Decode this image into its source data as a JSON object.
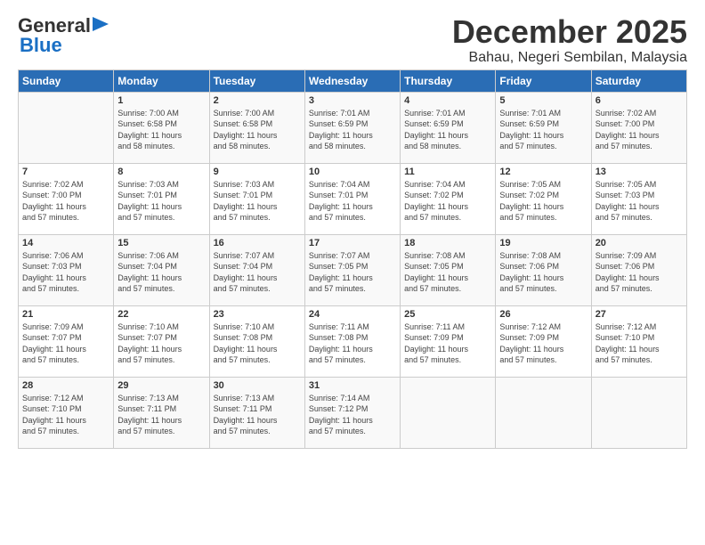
{
  "logo": {
    "general": "General",
    "blue": "Blue"
  },
  "title": {
    "month_year": "December 2025",
    "location": "Bahau, Negeri Sembilan, Malaysia"
  },
  "weekdays": [
    "Sunday",
    "Monday",
    "Tuesday",
    "Wednesday",
    "Thursday",
    "Friday",
    "Saturday"
  ],
  "weeks": [
    [
      {
        "day": "",
        "info": ""
      },
      {
        "day": "1",
        "info": "Sunrise: 7:00 AM\nSunset: 6:58 PM\nDaylight: 11 hours\nand 58 minutes."
      },
      {
        "day": "2",
        "info": "Sunrise: 7:00 AM\nSunset: 6:58 PM\nDaylight: 11 hours\nand 58 minutes."
      },
      {
        "day": "3",
        "info": "Sunrise: 7:01 AM\nSunset: 6:59 PM\nDaylight: 11 hours\nand 58 minutes."
      },
      {
        "day": "4",
        "info": "Sunrise: 7:01 AM\nSunset: 6:59 PM\nDaylight: 11 hours\nand 58 minutes."
      },
      {
        "day": "5",
        "info": "Sunrise: 7:01 AM\nSunset: 6:59 PM\nDaylight: 11 hours\nand 57 minutes."
      },
      {
        "day": "6",
        "info": "Sunrise: 7:02 AM\nSunset: 7:00 PM\nDaylight: 11 hours\nand 57 minutes."
      }
    ],
    [
      {
        "day": "7",
        "info": "Sunrise: 7:02 AM\nSunset: 7:00 PM\nDaylight: 11 hours\nand 57 minutes."
      },
      {
        "day": "8",
        "info": "Sunrise: 7:03 AM\nSunset: 7:01 PM\nDaylight: 11 hours\nand 57 minutes."
      },
      {
        "day": "9",
        "info": "Sunrise: 7:03 AM\nSunset: 7:01 PM\nDaylight: 11 hours\nand 57 minutes."
      },
      {
        "day": "10",
        "info": "Sunrise: 7:04 AM\nSunset: 7:01 PM\nDaylight: 11 hours\nand 57 minutes."
      },
      {
        "day": "11",
        "info": "Sunrise: 7:04 AM\nSunset: 7:02 PM\nDaylight: 11 hours\nand 57 minutes."
      },
      {
        "day": "12",
        "info": "Sunrise: 7:05 AM\nSunset: 7:02 PM\nDaylight: 11 hours\nand 57 minutes."
      },
      {
        "day": "13",
        "info": "Sunrise: 7:05 AM\nSunset: 7:03 PM\nDaylight: 11 hours\nand 57 minutes."
      }
    ],
    [
      {
        "day": "14",
        "info": "Sunrise: 7:06 AM\nSunset: 7:03 PM\nDaylight: 11 hours\nand 57 minutes."
      },
      {
        "day": "15",
        "info": "Sunrise: 7:06 AM\nSunset: 7:04 PM\nDaylight: 11 hours\nand 57 minutes."
      },
      {
        "day": "16",
        "info": "Sunrise: 7:07 AM\nSunset: 7:04 PM\nDaylight: 11 hours\nand 57 minutes."
      },
      {
        "day": "17",
        "info": "Sunrise: 7:07 AM\nSunset: 7:05 PM\nDaylight: 11 hours\nand 57 minutes."
      },
      {
        "day": "18",
        "info": "Sunrise: 7:08 AM\nSunset: 7:05 PM\nDaylight: 11 hours\nand 57 minutes."
      },
      {
        "day": "19",
        "info": "Sunrise: 7:08 AM\nSunset: 7:06 PM\nDaylight: 11 hours\nand 57 minutes."
      },
      {
        "day": "20",
        "info": "Sunrise: 7:09 AM\nSunset: 7:06 PM\nDaylight: 11 hours\nand 57 minutes."
      }
    ],
    [
      {
        "day": "21",
        "info": "Sunrise: 7:09 AM\nSunset: 7:07 PM\nDaylight: 11 hours\nand 57 minutes."
      },
      {
        "day": "22",
        "info": "Sunrise: 7:10 AM\nSunset: 7:07 PM\nDaylight: 11 hours\nand 57 minutes."
      },
      {
        "day": "23",
        "info": "Sunrise: 7:10 AM\nSunset: 7:08 PM\nDaylight: 11 hours\nand 57 minutes."
      },
      {
        "day": "24",
        "info": "Sunrise: 7:11 AM\nSunset: 7:08 PM\nDaylight: 11 hours\nand 57 minutes."
      },
      {
        "day": "25",
        "info": "Sunrise: 7:11 AM\nSunset: 7:09 PM\nDaylight: 11 hours\nand 57 minutes."
      },
      {
        "day": "26",
        "info": "Sunrise: 7:12 AM\nSunset: 7:09 PM\nDaylight: 11 hours\nand 57 minutes."
      },
      {
        "day": "27",
        "info": "Sunrise: 7:12 AM\nSunset: 7:10 PM\nDaylight: 11 hours\nand 57 minutes."
      }
    ],
    [
      {
        "day": "28",
        "info": "Sunrise: 7:12 AM\nSunset: 7:10 PM\nDaylight: 11 hours\nand 57 minutes."
      },
      {
        "day": "29",
        "info": "Sunrise: 7:13 AM\nSunset: 7:11 PM\nDaylight: 11 hours\nand 57 minutes."
      },
      {
        "day": "30",
        "info": "Sunrise: 7:13 AM\nSunset: 7:11 PM\nDaylight: 11 hours\nand 57 minutes."
      },
      {
        "day": "31",
        "info": "Sunrise: 7:14 AM\nSunset: 7:12 PM\nDaylight: 11 hours\nand 57 minutes."
      },
      {
        "day": "",
        "info": ""
      },
      {
        "day": "",
        "info": ""
      },
      {
        "day": "",
        "info": ""
      }
    ]
  ]
}
